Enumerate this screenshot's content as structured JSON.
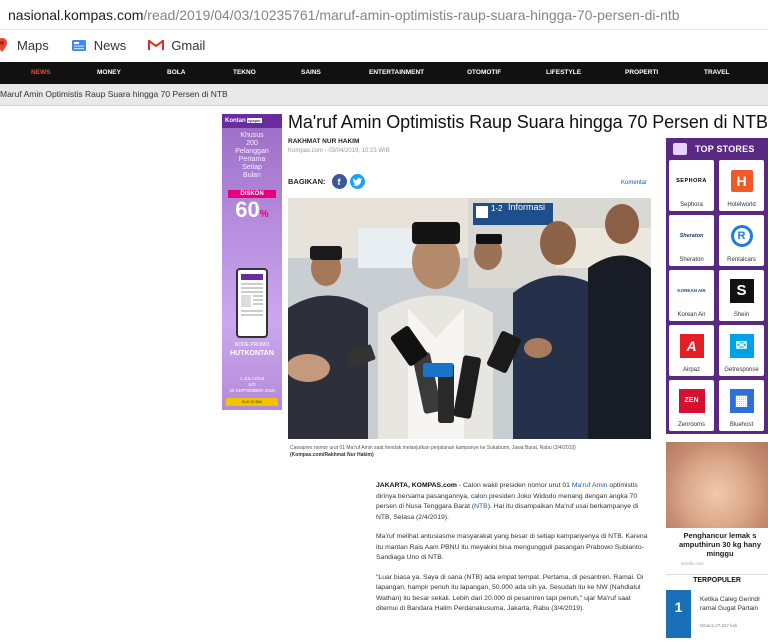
{
  "browser": {
    "url_host": "nasional.kompas.com",
    "url_path": "/read/2019/04/03/10235761/maruf-amin-optimistis-raup-suara-hingga-70-persen-di-ntb",
    "bookmarks": [
      {
        "label": "Maps",
        "icon": "maps-icon"
      },
      {
        "label": "News",
        "icon": "news-icon"
      },
      {
        "label": "Gmail",
        "icon": "gmail-icon"
      }
    ]
  },
  "nav": {
    "items": [
      "NEWS",
      "MONEY",
      "BOLA",
      "TEKNO",
      "SAINS",
      "ENTERTAINMENT",
      "OTOMOTIF",
      "LIFESTYLE",
      "PROPERTI",
      "TRAVEL"
    ],
    "active_color": "#f04e23"
  },
  "crumb": "Maruf Amin Optimistis Raup Suara hingga 70 Persen di NTB",
  "ad": {
    "brand": "Kontan",
    "brand_tag": "epaper",
    "line1": "Khusus",
    "line2": "200",
    "line3": "Pelanggan",
    "line4": "Pertama",
    "line5": "Setiap",
    "line6": "Bulan",
    "diskon": "DISKON",
    "percent": "60",
    "promo_label": "KODE PROMO",
    "promo_code": "HUTKONTAN",
    "date1": "1 JULI 2019",
    "date2": "S/D",
    "date3": "30 SEPTEMBER 2019",
    "footer": "KLIK DI SINI"
  },
  "article": {
    "title": "Ma'ruf Amin Optimistis Raup Suara hingga 70 Persen di NTB",
    "author": "RAKHMAT NUR HAKIM",
    "date": "Kompas.com - 03/04/2019, 10:23 WIB",
    "share_label": "BAGIKAN:",
    "comment_label": "Komentar",
    "photo_sign": "Informasi",
    "photo_gate": "1-2",
    "caption": "Cawapres nomor urut 01 Ma'ruf Amin saat hendak melanjutkan perjalanan kampanye ke Sukabumi, Jawa Barat, Rabu (3/4/2019)",
    "caption_credit": "(Kompas.com/Rakhmat Nur Hakim)",
    "p1_lead": "JAKARTA, KOMPAS.com",
    "p1_a": " - Calon wakil presiden nomor urut 01 ",
    "p1_link": "Ma'ruf Amin",
    "p1_b": " optimistis dirinya bersama pasangannya, calon presiden Joko Widodo menang dengan angka 70 persen di Nusa Tenggara Barat (",
    "p1_link2": "NTB",
    "p1_c": "). Hal itu disampaikan Ma'ruf usai berkampanye di NTB, Selasa (2/4/2019).",
    "p2": "Ma'ruf melihat antusiasme masyarakat yang besar di setiap kampanyenya di NTB. Karena itu mantan Rais Aam PBNU itu meyakini bisa mengungguli pasangan Prabowo Subianto-Sandiaga Uno di NTB.",
    "p3": "\"Luar biasa ya. Saya di sana (NTB) ada empat tempat. Pertama, di pesantren. Ramai. Di lapangan, hampir penuh itu lapangan, 50.000 ada sih ya. Sesudah itu ke NW (Nahdlatul Wathan) itu besar sekali. Lebih dari 20.000 di pesantren tapi penuh,\" ujar Ma'ruf saat ditemui di Bandara Halim Perdanakusuma, Jakarta, Rabu (3/4/2019)."
  },
  "stores": {
    "title": "TOP STORES",
    "items": [
      {
        "name": "Sephora",
        "logo": "SEPHORA",
        "icon": "sephora-logo"
      },
      {
        "name": "Hotelworld",
        "logo": "H",
        "icon": "hotelworld-logo"
      },
      {
        "name": "Sheraton",
        "logo": "Sheraton",
        "icon": "sheraton-logo"
      },
      {
        "name": "Rentalcars",
        "logo": "R",
        "icon": "rentalcars-logo"
      },
      {
        "name": "Korean Air",
        "logo": "KOREAN AIR",
        "icon": "korean-air-logo"
      },
      {
        "name": "Shein",
        "logo": "S",
        "icon": "shein-logo"
      },
      {
        "name": "Airpaz",
        "logo": "A",
        "icon": "airpaz-logo"
      },
      {
        "name": "Getresponse",
        "logo": "✉",
        "icon": "getresponse-logo"
      },
      {
        "name": "Zenrooms",
        "logo": "ZEN",
        "icon": "zenrooms-logo"
      },
      {
        "name": "Bluehost",
        "logo": "▦",
        "icon": "bluehost-logo"
      }
    ]
  },
  "sidebar_ad": {
    "title": "Penghancur lemak s amputhirun 30 kg hany minggu",
    "source": "ketofix.com"
  },
  "terpopuler": {
    "title": "TERPOPULER",
    "rank": "1",
    "item_title_1": "Ketika Caleg Gerindr",
    "item_title_2": "ramai Gugat Partain",
    "count": "Dibaca 27.527 kali"
  }
}
